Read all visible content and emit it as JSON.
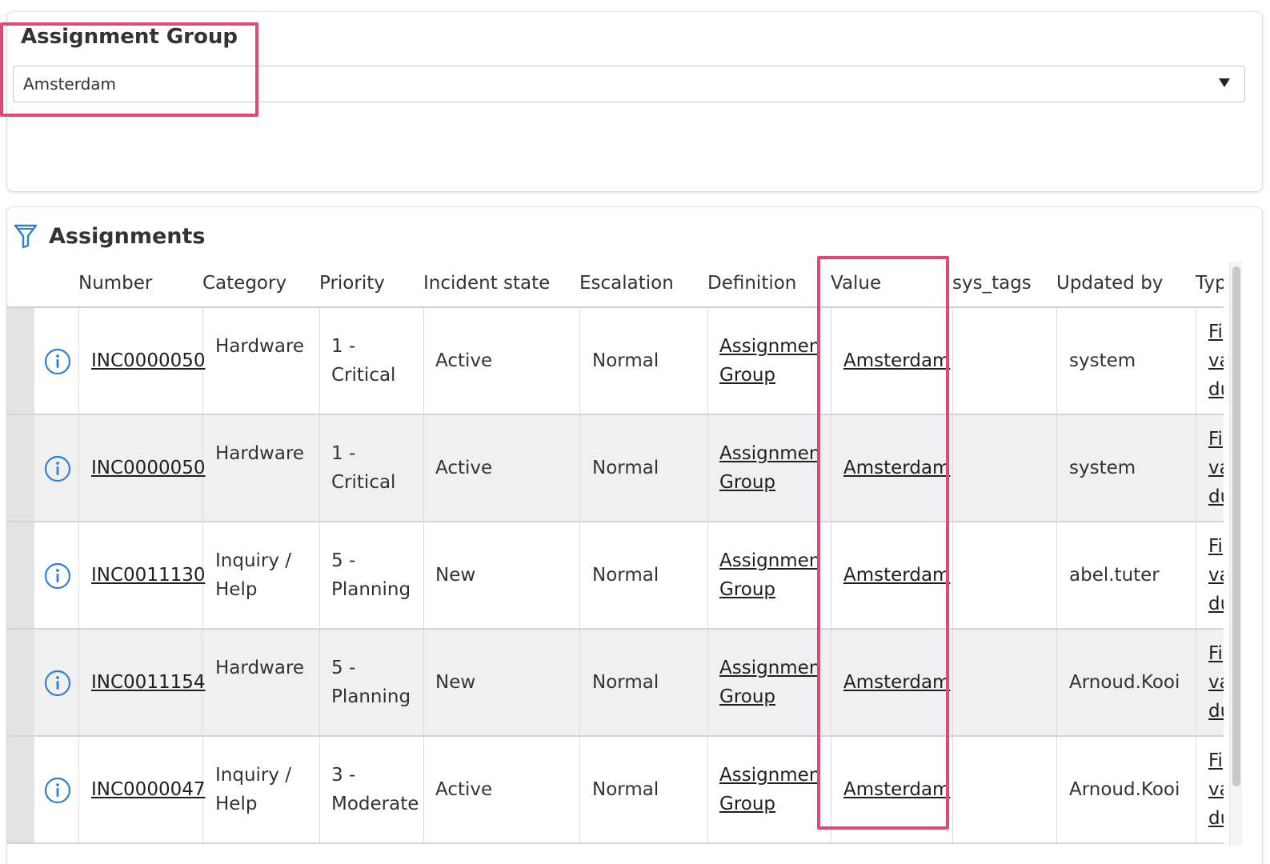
{
  "filter": {
    "label": "Assignment Group",
    "selected_value": "Amsterdam"
  },
  "list": {
    "title": "Assignments",
    "columns": [
      "Number",
      "Category",
      "Priority",
      "Incident state",
      "Escalation",
      "Definition",
      "Value",
      "sys_tags",
      "Updated by",
      "Typ"
    ],
    "rows": [
      {
        "number": "INC0000050",
        "category_l1": "Hardware",
        "category_l2": "",
        "priority_l1": "1 -",
        "priority_l2": "Critical",
        "state": "Active",
        "escalation": "Normal",
        "definition_l1": "Assignment",
        "definition_l2": "Group",
        "value": "Amsterdam",
        "sys_tags": "",
        "updated_by": "system",
        "type_l1": "Fi",
        "type_l2": "va",
        "type_l3": "du"
      },
      {
        "number": "INC0000050",
        "category_l1": "Hardware",
        "category_l2": "",
        "priority_l1": "1 -",
        "priority_l2": "Critical",
        "state": "Active",
        "escalation": "Normal",
        "definition_l1": "Assignment",
        "definition_l2": "Group",
        "value": "Amsterdam",
        "sys_tags": "",
        "updated_by": "system",
        "type_l1": "Fi",
        "type_l2": "va",
        "type_l3": "du"
      },
      {
        "number": "INC0011130",
        "category_l1": "Inquiry /",
        "category_l2": "Help",
        "priority_l1": "5 -",
        "priority_l2": "Planning",
        "state": "New",
        "escalation": "Normal",
        "definition_l1": "Assignment",
        "definition_l2": "Group",
        "value": "Amsterdam",
        "sys_tags": "",
        "updated_by": "abel.tuter",
        "type_l1": "Fi",
        "type_l2": "va",
        "type_l3": "du"
      },
      {
        "number": "INC0011154",
        "category_l1": "Hardware",
        "category_l2": "",
        "priority_l1": "5 -",
        "priority_l2": "Planning",
        "state": "New",
        "escalation": "Normal",
        "definition_l1": "Assignment",
        "definition_l2": "Group",
        "value": "Amsterdam",
        "sys_tags": "",
        "updated_by": "Arnoud.Kooi",
        "type_l1": "Fi",
        "type_l2": "va",
        "type_l3": "du"
      },
      {
        "number": "INC0000047",
        "category_l1": "Inquiry /",
        "category_l2": "Help",
        "priority_l1": "3 -",
        "priority_l2": "Moderate",
        "state": "Active",
        "escalation": "Normal",
        "definition_l1": "Assignment",
        "definition_l2": "Group",
        "value": "Amsterdam",
        "sys_tags": "",
        "updated_by": "Arnoud.Kooi",
        "type_l1": "Fi",
        "type_l2": "va",
        "type_l3": "du"
      }
    ]
  },
  "colors": {
    "highlight": "#e04a70",
    "info_icon": "#2f7fd6",
    "filter_icon": "#2f7fd6"
  },
  "icons": {
    "filter": "funnel-icon",
    "row_info": "info-circle-icon",
    "select_caret": "caret-down-icon"
  }
}
